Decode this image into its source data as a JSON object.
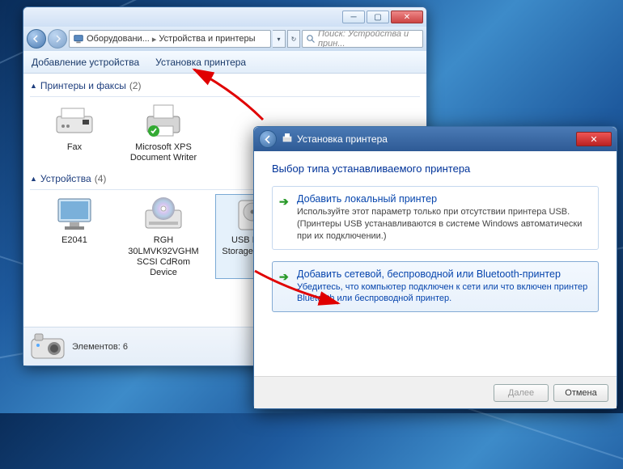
{
  "win1": {
    "address": {
      "part1": "Оборудовани...",
      "part2": "Устройства и принтеры"
    },
    "search_placeholder": "Поиск: Устройства и прин...",
    "toolbar": {
      "add_device": "Добавление устройства",
      "install_printer": "Установка принтера"
    },
    "groups": {
      "printers": {
        "label": "Принтеры и факсы",
        "count": "(2)"
      },
      "devices": {
        "label": "Устройства",
        "count": "(4)"
      }
    },
    "items": {
      "fax": "Fax",
      "xps": "Microsoft XPS Document Writer",
      "e2041": "E2041",
      "rgh": "RGH 30LMVK92VGHM SCSI CdRom Device",
      "usb": "USB Mass Storage Device"
    },
    "status": {
      "elements_label": "Элементов: 6"
    }
  },
  "win2": {
    "title": "Установка принтера",
    "heading": "Выбор типа устанавливаемого принтера",
    "opt_local": {
      "title": "Добавить локальный принтер",
      "desc": "Используйте этот параметр только при отсутствии принтера USB. (Принтеры USB устанавливаются в системе Windows автоматически при их подключении.)"
    },
    "opt_network": {
      "title": "Добавить сетевой, беспроводной или Bluetooth-принтер",
      "desc": "Убедитесь, что компьютер подключен к сети или что включен принтер Bluetooth или беспроводной принтер."
    },
    "buttons": {
      "next": "Далее",
      "cancel": "Отмена"
    }
  }
}
